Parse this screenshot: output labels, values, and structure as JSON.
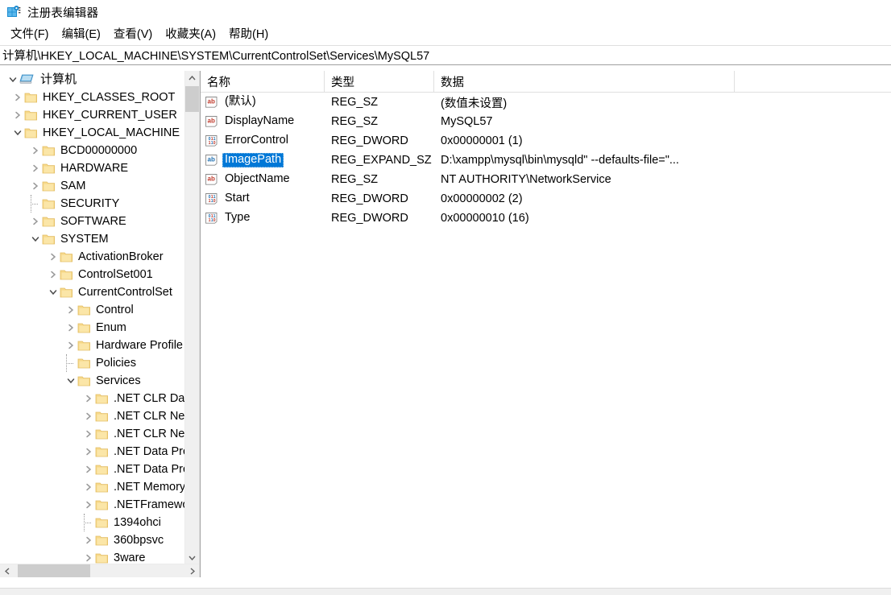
{
  "window": {
    "title": "注册表编辑器",
    "icon": "regedit-icon"
  },
  "menubar": {
    "items": [
      {
        "label": "文件(F)",
        "name": "menu-file"
      },
      {
        "label": "编辑(E)",
        "name": "menu-edit"
      },
      {
        "label": "查看(V)",
        "name": "menu-view"
      },
      {
        "label": "收藏夹(A)",
        "name": "menu-favorites"
      },
      {
        "label": "帮助(H)",
        "name": "menu-help"
      }
    ]
  },
  "address": {
    "path": "计算机\\HKEY_LOCAL_MACHINE\\SYSTEM\\CurrentControlSet\\Services\\MySQL57"
  },
  "tree": {
    "nodes": [
      {
        "label": "计算机",
        "depth": 0,
        "state": "expanded",
        "icon": "computer-icon"
      },
      {
        "label": "HKEY_CLASSES_ROOT",
        "depth": 1,
        "state": "collapsed",
        "icon": "folder-icon"
      },
      {
        "label": "HKEY_CURRENT_USER",
        "depth": 1,
        "state": "collapsed",
        "icon": "folder-icon"
      },
      {
        "label": "HKEY_LOCAL_MACHINE",
        "depth": 1,
        "state": "expanded",
        "icon": "folder-icon"
      },
      {
        "label": "BCD00000000",
        "depth": 2,
        "state": "collapsed",
        "icon": "folder-icon"
      },
      {
        "label": "HARDWARE",
        "depth": 2,
        "state": "collapsed",
        "icon": "folder-icon"
      },
      {
        "label": "SAM",
        "depth": 2,
        "state": "collapsed",
        "icon": "folder-icon"
      },
      {
        "label": "SECURITY",
        "depth": 2,
        "state": "leaf",
        "icon": "folder-icon"
      },
      {
        "label": "SOFTWARE",
        "depth": 2,
        "state": "collapsed",
        "icon": "folder-icon"
      },
      {
        "label": "SYSTEM",
        "depth": 2,
        "state": "expanded",
        "icon": "folder-icon"
      },
      {
        "label": "ActivationBroker",
        "depth": 3,
        "state": "collapsed",
        "icon": "folder-icon"
      },
      {
        "label": "ControlSet001",
        "depth": 3,
        "state": "collapsed",
        "icon": "folder-icon"
      },
      {
        "label": "CurrentControlSet",
        "depth": 3,
        "state": "expanded",
        "icon": "folder-icon"
      },
      {
        "label": "Control",
        "depth": 4,
        "state": "collapsed",
        "icon": "folder-icon"
      },
      {
        "label": "Enum",
        "depth": 4,
        "state": "collapsed",
        "icon": "folder-icon"
      },
      {
        "label": "Hardware Profile",
        "depth": 4,
        "state": "collapsed",
        "icon": "folder-icon"
      },
      {
        "label": "Policies",
        "depth": 4,
        "state": "leaf",
        "icon": "folder-icon"
      },
      {
        "label": "Services",
        "depth": 4,
        "state": "expanded",
        "icon": "folder-icon"
      },
      {
        "label": ".NET CLR Data",
        "depth": 5,
        "state": "collapsed",
        "icon": "folder-icon"
      },
      {
        "label": ".NET CLR Net",
        "depth": 5,
        "state": "collapsed",
        "icon": "folder-icon"
      },
      {
        "label": ".NET CLR Net",
        "depth": 5,
        "state": "collapsed",
        "icon": "folder-icon"
      },
      {
        "label": ".NET Data Pro",
        "depth": 5,
        "state": "collapsed",
        "icon": "folder-icon"
      },
      {
        "label": ".NET Data Pro",
        "depth": 5,
        "state": "collapsed",
        "icon": "folder-icon"
      },
      {
        "label": ".NET Memory",
        "depth": 5,
        "state": "collapsed",
        "icon": "folder-icon"
      },
      {
        "label": ".NETFramewo",
        "depth": 5,
        "state": "collapsed",
        "icon": "folder-icon"
      },
      {
        "label": "1394ohci",
        "depth": 5,
        "state": "leaf",
        "icon": "folder-icon"
      },
      {
        "label": "360bpsvc",
        "depth": 5,
        "state": "collapsed",
        "icon": "folder-icon"
      },
      {
        "label": "3ware",
        "depth": 5,
        "state": "collapsed",
        "icon": "folder-icon"
      }
    ]
  },
  "list": {
    "columns": [
      {
        "label": "名称",
        "name": "column-name"
      },
      {
        "label": "类型",
        "name": "column-type"
      },
      {
        "label": "数据",
        "name": "column-data"
      }
    ],
    "rows": [
      {
        "name": "(默认)",
        "type": "REG_SZ",
        "data": "(数值未设置)",
        "icon": "string-value-icon",
        "selected": false
      },
      {
        "name": "DisplayName",
        "type": "REG_SZ",
        "data": "MySQL57",
        "icon": "string-value-icon",
        "selected": false
      },
      {
        "name": "ErrorControl",
        "type": "REG_DWORD",
        "data": "0x00000001 (1)",
        "icon": "dword-value-icon",
        "selected": false
      },
      {
        "name": "ImagePath",
        "type": "REG_EXPAND_SZ",
        "data": "D:\\xampp\\mysql\\bin\\mysqld\" --defaults-file=\"...",
        "icon": "string-value-icon",
        "selected": true
      },
      {
        "name": "ObjectName",
        "type": "REG_SZ",
        "data": "NT AUTHORITY\\NetworkService",
        "icon": "string-value-icon",
        "selected": false
      },
      {
        "name": "Start",
        "type": "REG_DWORD",
        "data": "0x00000002 (2)",
        "icon": "dword-value-icon",
        "selected": false
      },
      {
        "name": "Type",
        "type": "REG_DWORD",
        "data": "0x00000010 (16)",
        "icon": "dword-value-icon",
        "selected": false
      }
    ]
  },
  "scrollbars": {
    "tree_vertical": {
      "up_arrow": "▲",
      "down_arrow": "▼"
    },
    "tree_horizontal": {
      "left_arrow": "◀",
      "right_arrow": "▶"
    }
  },
  "colors": {
    "selection_blue": "#0078d7",
    "folder_yellow": "#f7d98b",
    "scrollbar_thumb": "#cdcdcd",
    "value_icon_red": "#c0392b"
  }
}
